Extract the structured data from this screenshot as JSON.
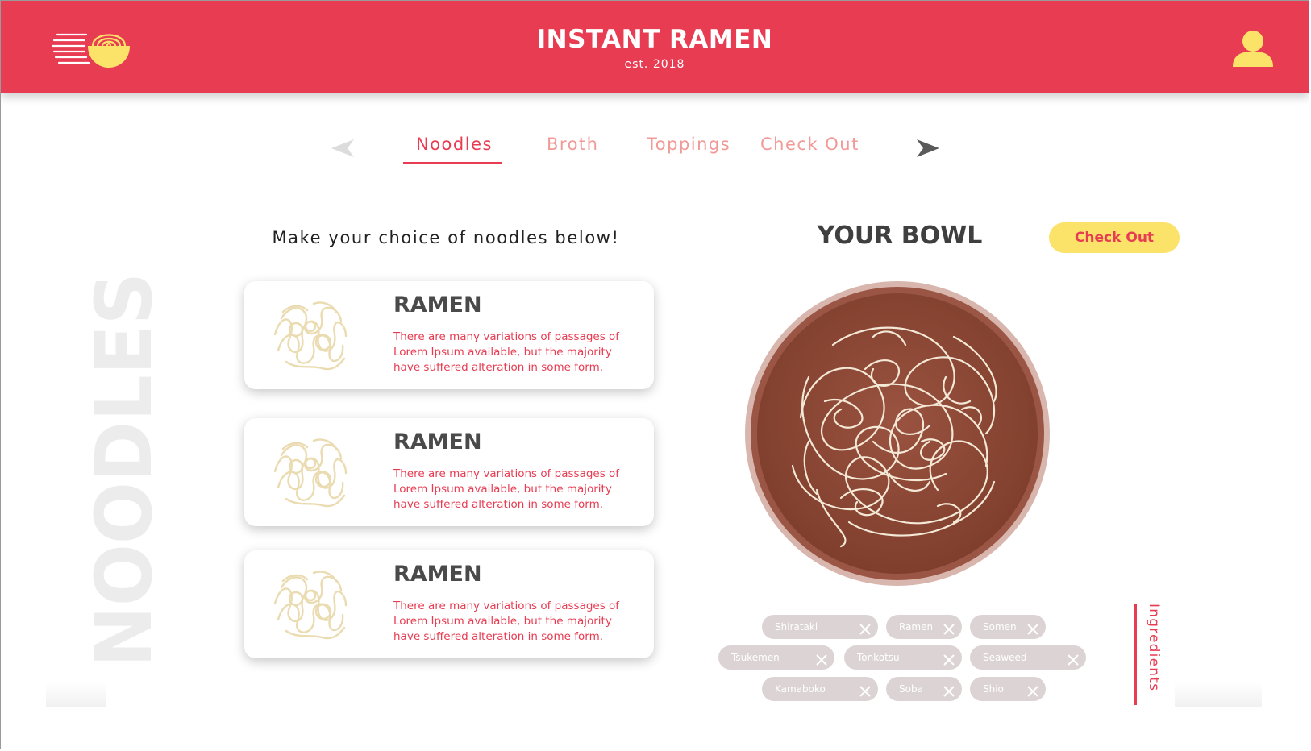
{
  "header": {
    "title": "INSTANT RAMEN",
    "subtitle": "est. 2018",
    "logo_icon": "ramen-bowl-icon",
    "user_icon": "user-icon",
    "background_color": "#e83c52"
  },
  "tabs": {
    "prev_icon": "arrow-left-icon",
    "next_icon": "arrow-right-icon",
    "items": [
      {
        "label": "Noodles",
        "active": true
      },
      {
        "label": "Broth",
        "active": false
      },
      {
        "label": "Toppings",
        "active": false
      },
      {
        "label": "Check Out",
        "active": false
      }
    ]
  },
  "side_label": "NOODLES",
  "noodles": {
    "prompt": "Make your choice of noodles below!",
    "cards": [
      {
        "title": "RAMEN",
        "description": "There are many variations of passages of Lorem Ipsum available, but the majority have suffered alteration in some form.",
        "image_icon": "noodles-icon"
      },
      {
        "title": "RAMEN",
        "description": "There are many variations of passages of Lorem Ipsum available, but the majority have suffered alteration in some form.",
        "image_icon": "noodles-icon"
      },
      {
        "title": "RAMEN",
        "description": "There are many variations of passages of Lorem Ipsum available, but the majority have suffered alteration in some form.",
        "image_icon": "noodles-icon"
      }
    ]
  },
  "bowl": {
    "title": "YOUR BOWL",
    "checkout_label": "Check Out",
    "bowl_image": "ramen-bowl-top-view",
    "chips": [
      "Shirataki",
      "Ramen",
      "Somen",
      "Tsukemen",
      "Tonkotsu",
      "Seaweed",
      "Kamaboko",
      "Soba",
      "Shio"
    ],
    "ingredients_label": "Ingredients"
  },
  "colors": {
    "accent": "#e83c52",
    "accent_light": "#f29a97",
    "button_yellow": "#fbe36a",
    "chip_gray": "#dcd4d4",
    "broth_brown": "#8f4a36"
  }
}
